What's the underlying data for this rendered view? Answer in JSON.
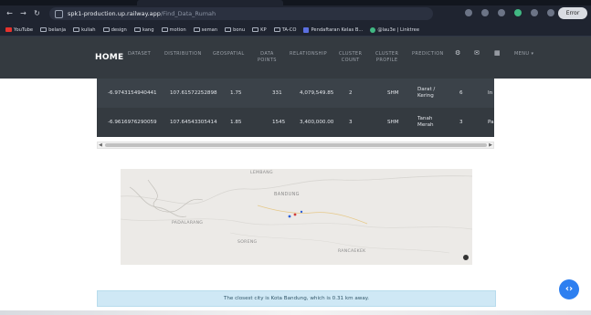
{
  "browser": {
    "url_host": "spk1-production.up.railway.app",
    "url_path": "/Find_Data_Rumah",
    "profile_label": "Error"
  },
  "bookmarks": [
    {
      "label": "YouTube",
      "icon": "youtube-icon"
    },
    {
      "label": "belanja",
      "icon": "folder-icon"
    },
    {
      "label": "kuliah",
      "icon": "folder-icon"
    },
    {
      "label": "design",
      "icon": "folder-icon"
    },
    {
      "label": "kang",
      "icon": "folder-icon"
    },
    {
      "label": "motion",
      "icon": "folder-icon"
    },
    {
      "label": "seman",
      "icon": "folder-icon"
    },
    {
      "label": "bonu",
      "icon": "folder-icon"
    },
    {
      "label": "KP",
      "icon": "folder-icon"
    },
    {
      "label": "TA-CO",
      "icon": "folder-icon"
    },
    {
      "label": "Pendaftaran Kelas B...",
      "icon": "form-icon"
    },
    {
      "label": "@lau3e | Linktree",
      "icon": "linktree-icon"
    }
  ],
  "nav": {
    "home": "HOME",
    "dataset": "DATASET",
    "distribution": "DISTRIBUTION",
    "geospatial": "GEOSPATIAL",
    "data_points_1": "DATA",
    "data_points_2": "POINTS",
    "relationship": "RELATIONSHIP",
    "cluster_count_1": "CLUSTER",
    "cluster_count_2": "COUNT",
    "cluster_profile_1": "CLUSTER",
    "cluster_profile_2": "PROFILE",
    "prediction": "PREDICTION",
    "menu": "MENU"
  },
  "table": {
    "rows": [
      {
        "lat": "-6.9743154940441",
        "lon": "107.61572252898",
        "v1": "1.75",
        "v2": "331",
        "price": "4,079,549.85",
        "v3": "2",
        "cert": "SHM",
        "type1": "Darat /",
        "type2": "Kering",
        "v4": "6",
        "extra": "In"
      },
      {
        "lat": "-6.9616976290059",
        "lon": "107.64543305414",
        "v1": "1.85",
        "v2": "1545",
        "price": "3,400,000.00",
        "v3": "3",
        "cert": "SHM",
        "type1": "Tanah",
        "type2": "Merah",
        "v4": "3",
        "extra": "Pa"
      }
    ]
  },
  "map": {
    "labels": {
      "lembang": "LEMBANG",
      "bandung": "BANDUNG",
      "padalarang": "PADALARANG",
      "soreang": "SORENG",
      "rancaekek": "RANCAEKEK"
    }
  },
  "alert": {
    "text": "The closest city is Kota Bandung, which is 0.31 km away."
  },
  "colors": {
    "navbar": "#343a40",
    "alert_bg": "#cfe8f5",
    "fab": "#2d7ff0"
  }
}
